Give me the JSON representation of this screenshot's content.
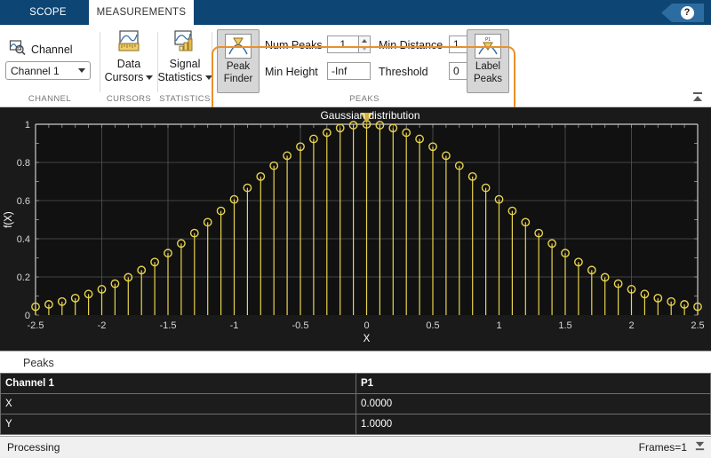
{
  "tabs": [
    {
      "label": "SCOPE",
      "active": false
    },
    {
      "label": "MEASUREMENTS",
      "active": true
    }
  ],
  "help": {
    "glyph": "?"
  },
  "ribbon": {
    "groups": [
      {
        "name": "CHANNEL",
        "label": "CHANNEL"
      },
      {
        "name": "CURSORS",
        "label": "CURSORS"
      },
      {
        "name": "STATISTICS",
        "label": "STATISTICS"
      },
      {
        "name": "PEAKS",
        "label": "PEAKS"
      }
    ],
    "channel": {
      "icon_label": "Channel",
      "select_value": "Channel 1"
    },
    "cursors": {
      "line1": "Data",
      "line2": "Cursors"
    },
    "statistics": {
      "line1": "Signal",
      "line2": "Statistics"
    },
    "peaks": {
      "peak_finder": {
        "line1": "Peak",
        "line2": "Finder"
      },
      "label_peaks": {
        "line1": "Label",
        "line2": "Peaks",
        "icon_tag": "P1"
      },
      "fields": [
        {
          "label": "Num Peaks",
          "value": "1"
        },
        {
          "label": "Min Height",
          "value": "-Inf"
        },
        {
          "label": "Min Distance",
          "value": "1"
        },
        {
          "label": "Threshold",
          "value": "0"
        }
      ]
    }
  },
  "peaks_panel": {
    "title": "Peaks",
    "columns": [
      "Channel 1",
      "P1"
    ],
    "rows": [
      {
        "label": "X",
        "value": "0.0000"
      },
      {
        "label": "Y",
        "value": "1.0000"
      }
    ]
  },
  "statusbar": {
    "left": "Processing",
    "right": "Frames=1"
  },
  "chart_data": {
    "type": "line",
    "plot_style": "stem",
    "title": "Gaussian distribution",
    "xlabel": "X",
    "ylabel": "f(X)",
    "xlim": [
      -2.5,
      2.5
    ],
    "ylim": [
      0,
      1
    ],
    "xticks": [
      -2.5,
      -2,
      -1.5,
      -1,
      -0.5,
      0,
      0.5,
      1,
      1.5,
      2,
      2.5
    ],
    "xticklabels": [
      "-2.5",
      "-2",
      "-1.5",
      "-1",
      "-0.5",
      "0",
      "0.5",
      "1",
      "1.5",
      "2",
      "2.5"
    ],
    "yticks": [
      0,
      0.2,
      0.4,
      0.6,
      0.8,
      1
    ],
    "yticklabels": [
      "0",
      "0.2",
      "0.4",
      "0.6",
      "0.8",
      "1"
    ],
    "grid": true,
    "background": "#1a1a1a",
    "series_color": "#e8d44d",
    "marker": "circle",
    "peak_marker": {
      "x": 0,
      "y": 1,
      "shape": "triangle-down",
      "color": "#d1b23a"
    },
    "x": [
      -2.5,
      -2.4,
      -2.3,
      -2.2,
      -2.1,
      -2.0,
      -1.9,
      -1.8,
      -1.7,
      -1.6,
      -1.5,
      -1.4,
      -1.3,
      -1.2,
      -1.1,
      -1.0,
      -0.9,
      -0.8,
      -0.7,
      -0.6,
      -0.5,
      -0.4,
      -0.3,
      -0.2,
      -0.1,
      0.0,
      0.1,
      0.2,
      0.3,
      0.4,
      0.5,
      0.6,
      0.7,
      0.8,
      0.9,
      1.0,
      1.1,
      1.2,
      1.3,
      1.4,
      1.5,
      1.6,
      1.7,
      1.8,
      1.9,
      2.0,
      2.1,
      2.2,
      2.3,
      2.4,
      2.5
    ],
    "y": [
      0.0439,
      0.0561,
      0.071,
      0.0889,
      0.1103,
      0.1353,
      0.1645,
      0.1979,
      0.2357,
      0.278,
      0.3247,
      0.3753,
      0.4296,
      0.4868,
      0.5461,
      0.6065,
      0.667,
      0.7261,
      0.7827,
      0.8353,
      0.8825,
      0.9231,
      0.956,
      0.9802,
      0.995,
      1.0,
      0.995,
      0.9802,
      0.956,
      0.9231,
      0.8825,
      0.8353,
      0.7827,
      0.7261,
      0.667,
      0.6065,
      0.5461,
      0.4868,
      0.4296,
      0.3753,
      0.3247,
      0.278,
      0.2357,
      0.1979,
      0.1645,
      0.1353,
      0.1103,
      0.0889,
      0.071,
      0.0561,
      0.0439
    ]
  }
}
